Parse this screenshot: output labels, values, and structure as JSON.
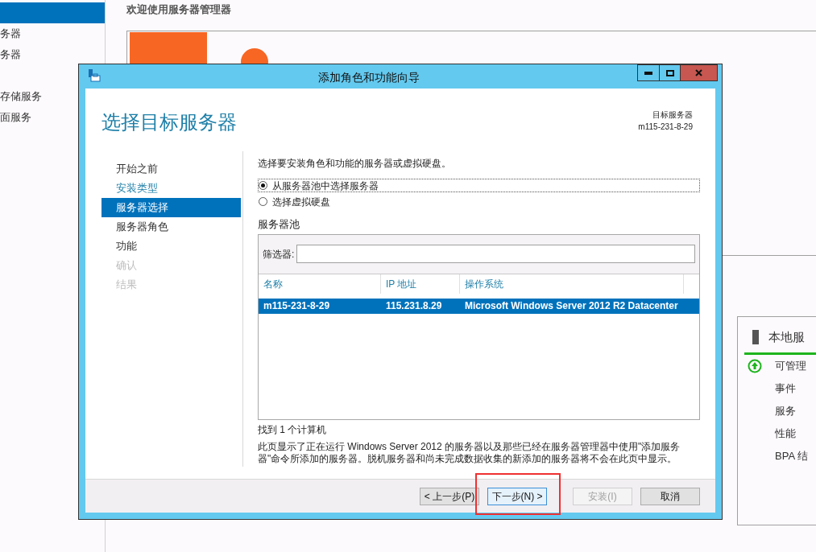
{
  "background": {
    "sidebar": {
      "items": [
        {
          "selected": true
        },
        {
          "label": "务器",
          "selected": false
        },
        {
          "label": "务器",
          "selected": false
        },
        {
          "label": "存储服务",
          "selected": false
        },
        {
          "label": "面服务",
          "selected": false
        }
      ]
    },
    "heading": "欢迎使用服务器管理器",
    "local_panel": {
      "title": "本地服",
      "rows": [
        {
          "label": "可管理",
          "kind": "status"
        },
        {
          "label": "事件",
          "kind": "plain"
        },
        {
          "label": "服务",
          "kind": "plain"
        },
        {
          "label": "性能",
          "kind": "plain"
        },
        {
          "label": "BPA 结",
          "kind": "plain"
        }
      ]
    }
  },
  "dialog": {
    "title": "添加角色和功能向导",
    "page_title": "选择目标服务器",
    "target_label": "目标服务器",
    "target_value": "m115-231-8-29",
    "steps": [
      {
        "label": "开始之前",
        "kind": "plain",
        "selected": false,
        "disabled": false
      },
      {
        "label": "安装类型",
        "kind": "link",
        "selected": false,
        "disabled": false
      },
      {
        "label": "服务器选择",
        "kind": "plain",
        "selected": true,
        "disabled": false
      },
      {
        "label": "服务器角色",
        "kind": "plain",
        "selected": false,
        "disabled": false
      },
      {
        "label": "功能",
        "kind": "plain",
        "selected": false,
        "disabled": false
      },
      {
        "label": "确认",
        "kind": "plain",
        "selected": false,
        "disabled": true
      },
      {
        "label": "结果",
        "kind": "plain",
        "selected": false,
        "disabled": true
      }
    ],
    "description": "选择要安装角色和功能的服务器或虚拟硬盘。",
    "options": [
      {
        "label": "从服务器池中选择服务器",
        "selected": true
      },
      {
        "label": "选择虚拟硬盘",
        "selected": false
      }
    ],
    "pool": {
      "title": "服务器池",
      "filter_label": "筛选器:",
      "columns": [
        "名称",
        "IP 地址",
        "操作系统"
      ],
      "rows": [
        {
          "cells": [
            "m115-231-8-29",
            "115.231.8.29",
            "Microsoft Windows Server 2012 R2 Datacenter"
          ],
          "selected": true
        }
      ]
    },
    "found": "找到 1 个计算机",
    "note": "此页显示了正在运行 Windows Server 2012 的服务器以及那些已经在服务器管理器中使用\"添加服务器\"命令所添加的服务器。脱机服务器和尚未完成数据收集的新添加的服务器将不会在此页中显示。",
    "buttons": [
      {
        "label": "< 上一步(P)",
        "disabled": false,
        "focused": false
      },
      {
        "label": "下一步(N) >",
        "disabled": false,
        "focused": true
      },
      {
        "label": "安装(I)",
        "disabled": true,
        "focused": false
      },
      {
        "label": "取消",
        "disabled": false,
        "focused": false
      }
    ]
  }
}
